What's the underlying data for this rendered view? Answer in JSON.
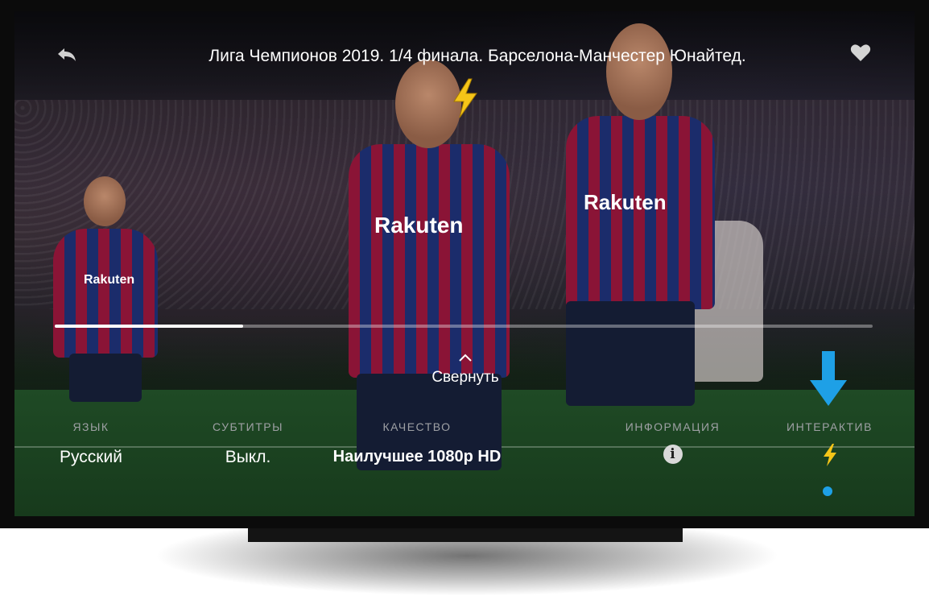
{
  "header": {
    "back_label": "back",
    "title": "Лига Чемпионов 2019. 1/4 финала. Барселона-Манчестер Юнайтед."
  },
  "player": {
    "progress": 0.23,
    "collapse_label": "Свернуть"
  },
  "settings": [
    {
      "label": "ЯЗЫК",
      "value": "Русский"
    },
    {
      "label": "СУБТИТРЫ",
      "value": "Выкл."
    },
    {
      "label": "КАЧЕСТВО",
      "value": "Наилучшее 1080p HD"
    },
    {
      "label": "ИНФОРМАЦИЯ",
      "value": "i"
    },
    {
      "label": "ИНТЕРАКТИВ",
      "value": ""
    }
  ],
  "sponsor_text": "Rakuten",
  "icons": {
    "back": "back-arrow-icon",
    "favorite": "heart-icon",
    "interactive": "lightning-icon",
    "info": "info-icon",
    "collapse": "chevron-up-icon",
    "hint": "arrow-down-icon"
  },
  "colors": {
    "accent_lightning": "#f5c518",
    "accent_blue": "#1ea0e6",
    "label_gray": "#9ea0a4"
  }
}
